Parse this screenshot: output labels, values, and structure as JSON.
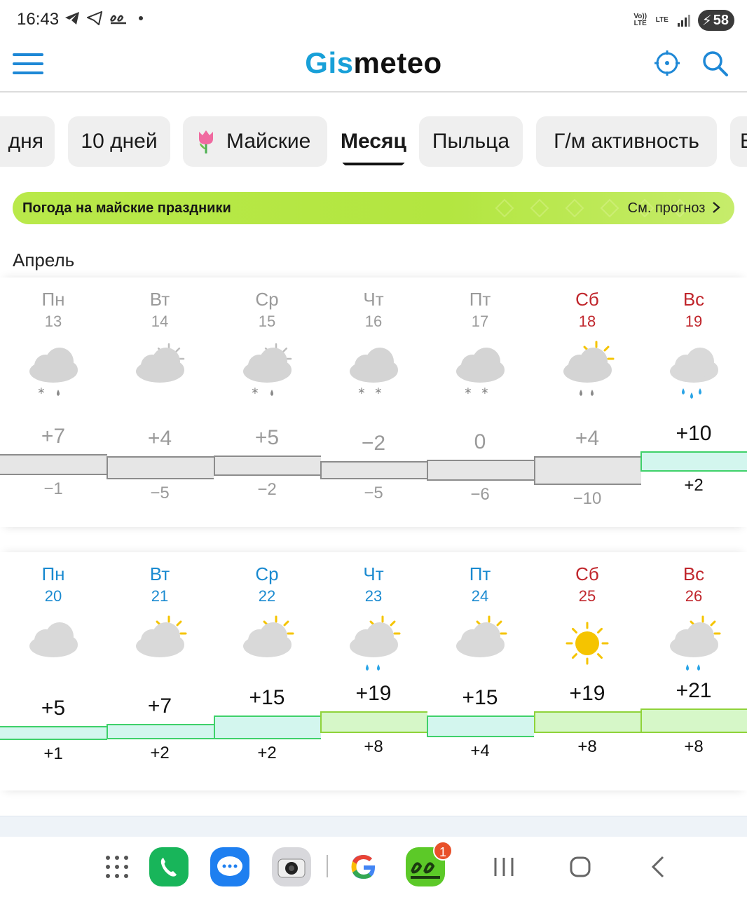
{
  "status_bar": {
    "time": "16:43",
    "net_label_1": "Vo)) LTE",
    "net_label_2": "LTE",
    "battery": "58"
  },
  "header": {
    "logo_part1": "Gis",
    "logo_part2": "meteo",
    "accent_color": "#18a0d8"
  },
  "tabs": [
    "дня",
    "10 дней",
    "Майские",
    "Месяц",
    "Пыльца",
    "Г/м активность"
  ],
  "active_tab": "Месяц",
  "banner": {
    "title": "Погода на майские праздники",
    "link": "См. прогноз"
  },
  "month": "Апрель",
  "weeks": [
    {
      "days": [
        {
          "name": "Пн",
          "date": "13",
          "icon": "cloudy-snow-rain-icon",
          "max": "+7",
          "min": "−1"
        },
        {
          "name": "Вт",
          "date": "14",
          "icon": "partly-cloudy-moon-icon",
          "max": "+4",
          "min": "−5"
        },
        {
          "name": "Ср",
          "date": "15",
          "icon": "partly-cloudy-moon-snow-rain-icon",
          "max": "+5",
          "min": "−2"
        },
        {
          "name": "Чт",
          "date": "16",
          "icon": "cloudy-snow-icon",
          "max": "−2",
          "min": "−5"
        },
        {
          "name": "Пт",
          "date": "17",
          "icon": "cloudy-snow-icon",
          "max": "0",
          "min": "−6"
        },
        {
          "name": "Сб",
          "date": "18",
          "icon": "partly-cloudy-sun-rain-icon",
          "max": "+4",
          "min": "−10"
        },
        {
          "name": "Вс",
          "date": "19",
          "icon": "cloudy-rain-icon",
          "max": "+10",
          "min": "+2"
        }
      ]
    },
    {
      "days": [
        {
          "name": "Пн",
          "date": "20",
          "icon": "cloudy-icon",
          "max": "+5",
          "min": "+1"
        },
        {
          "name": "Вт",
          "date": "21",
          "icon": "partly-cloudy-sun-icon",
          "max": "+7",
          "min": "+2"
        },
        {
          "name": "Ср",
          "date": "22",
          "icon": "partly-cloudy-sun-icon",
          "max": "+15",
          "min": "+2"
        },
        {
          "name": "Чт",
          "date": "23",
          "icon": "partly-cloudy-sun-rain-icon",
          "max": "+19",
          "min": "+8"
        },
        {
          "name": "Пт",
          "date": "24",
          "icon": "partly-cloudy-sun-icon",
          "max": "+15",
          "min": "+4"
        },
        {
          "name": "Сб",
          "date": "25",
          "icon": "sunny-icon",
          "max": "+19",
          "min": "+8"
        },
        {
          "name": "Вс",
          "date": "26",
          "icon": "partly-cloudy-sun-rain-icon",
          "max": "+21",
          "min": "+8"
        }
      ]
    }
  ],
  "colors": {
    "cold_band": "#e6e6e6",
    "mild_band": "#d3f6ee",
    "warm_band": "#d6f7c8",
    "weekend_red": "#c0262c",
    "weekday_blue": "#1a8ad0",
    "past_gray": "#9a9a9a"
  },
  "nav": {
    "notification_count": "1",
    "apps": [
      "apps-grid-icon",
      "phone-icon",
      "messages-icon",
      "camera-icon",
      "google-icon",
      "ee-app-icon"
    ]
  }
}
